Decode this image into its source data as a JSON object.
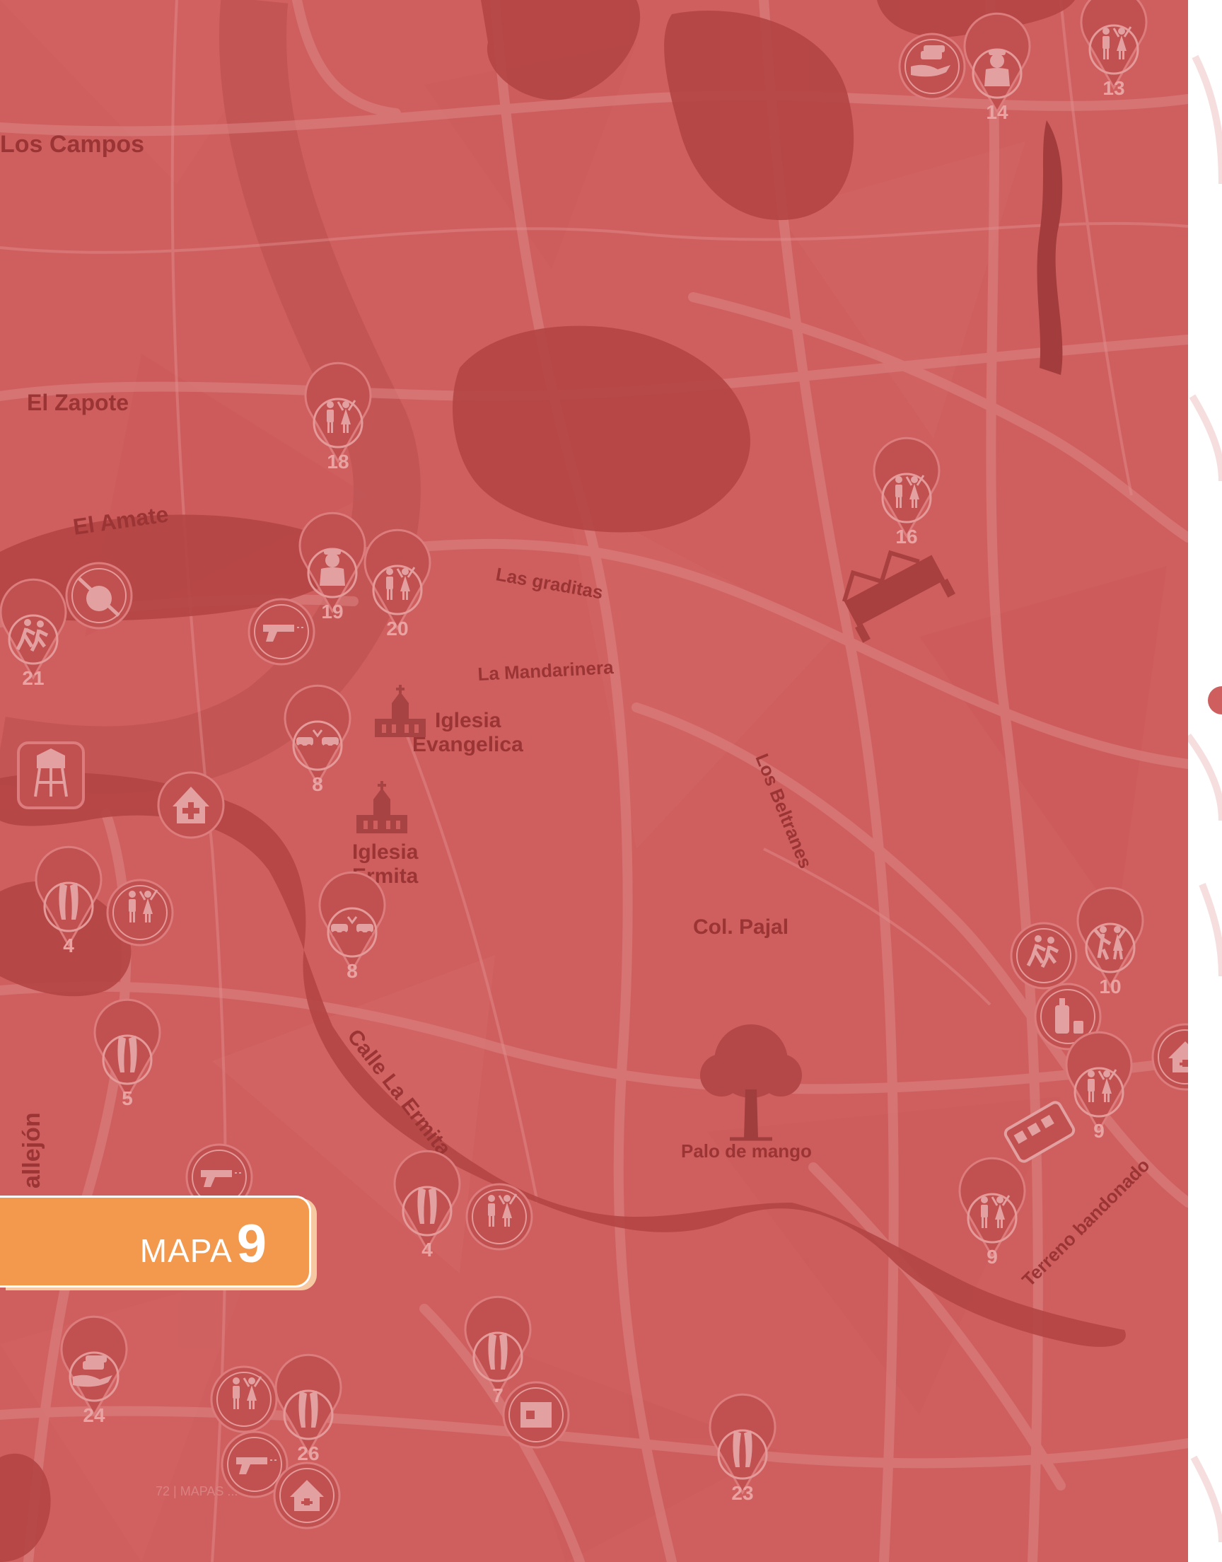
{
  "colors": {
    "map_fill": "#cf5f5f",
    "road": "#dd8585",
    "vegetation": "#b44545",
    "label": "#9b3434",
    "pin": "#c15050",
    "badge": "#f2994e"
  },
  "badge": {
    "word": "MAPA",
    "number": "9"
  },
  "footer": "72 | MAPAS ...",
  "labels": {
    "los_campos": "Los Campos",
    "el_zapote": "El Zapote",
    "el_amate": "El Amate",
    "las_graditas": "Las graditas",
    "la_mandarinera": "La Mandarinera",
    "iglesia_evangelica_1": "Iglesia",
    "iglesia_evangelica_2": "Evangelica",
    "iglesia_ermita_1": "Iglesia",
    "iglesia_ermita_2": "Ermita",
    "los_beltranes": "Los Beltranes",
    "col_pajal": "Col. Pajal",
    "calle_la_ermita": "Calle La Ermita",
    "palo_de_mango": "Palo de mango",
    "terreno_abandonado": "Terreno bandonado",
    "callejon": "allejón"
  },
  "markers": [
    {
      "id": "m13",
      "icon": "couple-icon",
      "number": "13"
    },
    {
      "id": "m14",
      "icon": "police-icon",
      "number": "14"
    },
    {
      "id": "m16",
      "icon": "couple-icon",
      "number": "16"
    },
    {
      "id": "m18",
      "icon": "couple-icon",
      "number": "18"
    },
    {
      "id": "m19",
      "icon": "police-icon",
      "number": "19"
    },
    {
      "id": "m20",
      "icon": "couple-icon",
      "number": "20"
    },
    {
      "id": "m21",
      "icon": "running-people-icon",
      "number": "21"
    },
    {
      "id": "m8a",
      "icon": "car-crash-icon",
      "number": "8"
    },
    {
      "id": "m8b",
      "icon": "car-crash-icon",
      "number": "8"
    },
    {
      "id": "m4a",
      "icon": "legs-icon",
      "number": "4"
    },
    {
      "id": "m5",
      "icon": "legs-icon",
      "number": "5"
    },
    {
      "id": "m4b",
      "icon": "legs-icon",
      "number": "4"
    },
    {
      "id": "m10",
      "icon": "dancing-couple-icon",
      "number": "10"
    },
    {
      "id": "m9a",
      "icon": "couple-icon",
      "number": "9"
    },
    {
      "id": "m9b",
      "icon": "couple-icon",
      "number": "9"
    },
    {
      "id": "m7",
      "icon": "legs-icon",
      "number": "7"
    },
    {
      "id": "m24",
      "icon": "money-hand-icon",
      "number": "24"
    },
    {
      "id": "m26",
      "icon": "legs-icon",
      "number": "26"
    },
    {
      "id": "m23",
      "icon": "legs-icon",
      "number": "23"
    }
  ]
}
